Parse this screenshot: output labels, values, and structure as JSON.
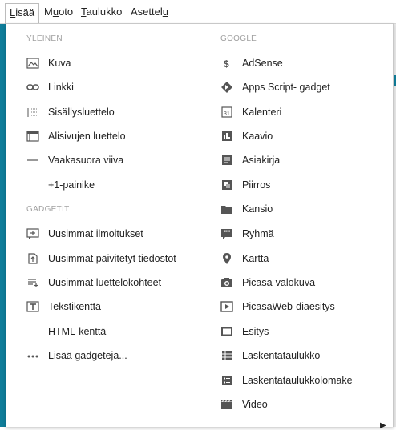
{
  "menubar": {
    "items": [
      {
        "pre": "",
        "u": "L",
        "post": "isää"
      },
      {
        "pre": "M",
        "u": "u",
        "post": "oto"
      },
      {
        "pre": "",
        "u": "T",
        "post": "aulukko"
      },
      {
        "pre": "Asettel",
        "u": "u",
        "post": ""
      }
    ]
  },
  "left": {
    "header1": "YLEINEN",
    "items1": [
      "Kuva",
      "Linkki",
      "Sisällysluettelo",
      "Alisivujen luettelo",
      "Vaakasuora viiva",
      "+1-painike"
    ],
    "header2": "GADGETIT",
    "items2": [
      "Uusimmat ilmoitukset",
      "Uusimmat päivitetyt tiedostot",
      "Uusimmat luettelokohteet",
      "Tekstikenttä",
      "HTML-kenttä",
      "Lisää gadgeteja..."
    ]
  },
  "right": {
    "header": "GOOGLE",
    "items": [
      "AdSense",
      "Apps Script- gadget",
      "Kalenteri",
      "Kaavio",
      "Asiakirja",
      "Piirros",
      "Kansio",
      "Ryhmä",
      "Kartta",
      "Picasa-valokuva",
      "PicasaWeb-diaesitys",
      "Esitys",
      "Laskentataulukko",
      "Laskentataulukkolomake",
      "Video"
    ]
  },
  "icons": {
    "left1": [
      "image-icon",
      "link-icon",
      "toc-icon",
      "subpages-icon",
      "horizontal-line-icon",
      ""
    ],
    "left2": [
      "announcements-icon",
      "file-upload-icon",
      "list-icon",
      "text-box-icon",
      "",
      "more-icon"
    ],
    "right": [
      "dollar-icon",
      "script-gadget-icon",
      "calendar-icon",
      "chart-icon",
      "document-icon",
      "drawing-icon",
      "folder-icon",
      "group-icon",
      "map-pin-icon",
      "camera-icon",
      "slideshow-icon",
      "presentation-icon",
      "spreadsheet-icon",
      "form-icon",
      "video-icon"
    ]
  },
  "submenu_arrow": "▶",
  "colors": {
    "accent": "#0f7d9a",
    "icon": "#555555",
    "header": "#a0a0a0"
  }
}
